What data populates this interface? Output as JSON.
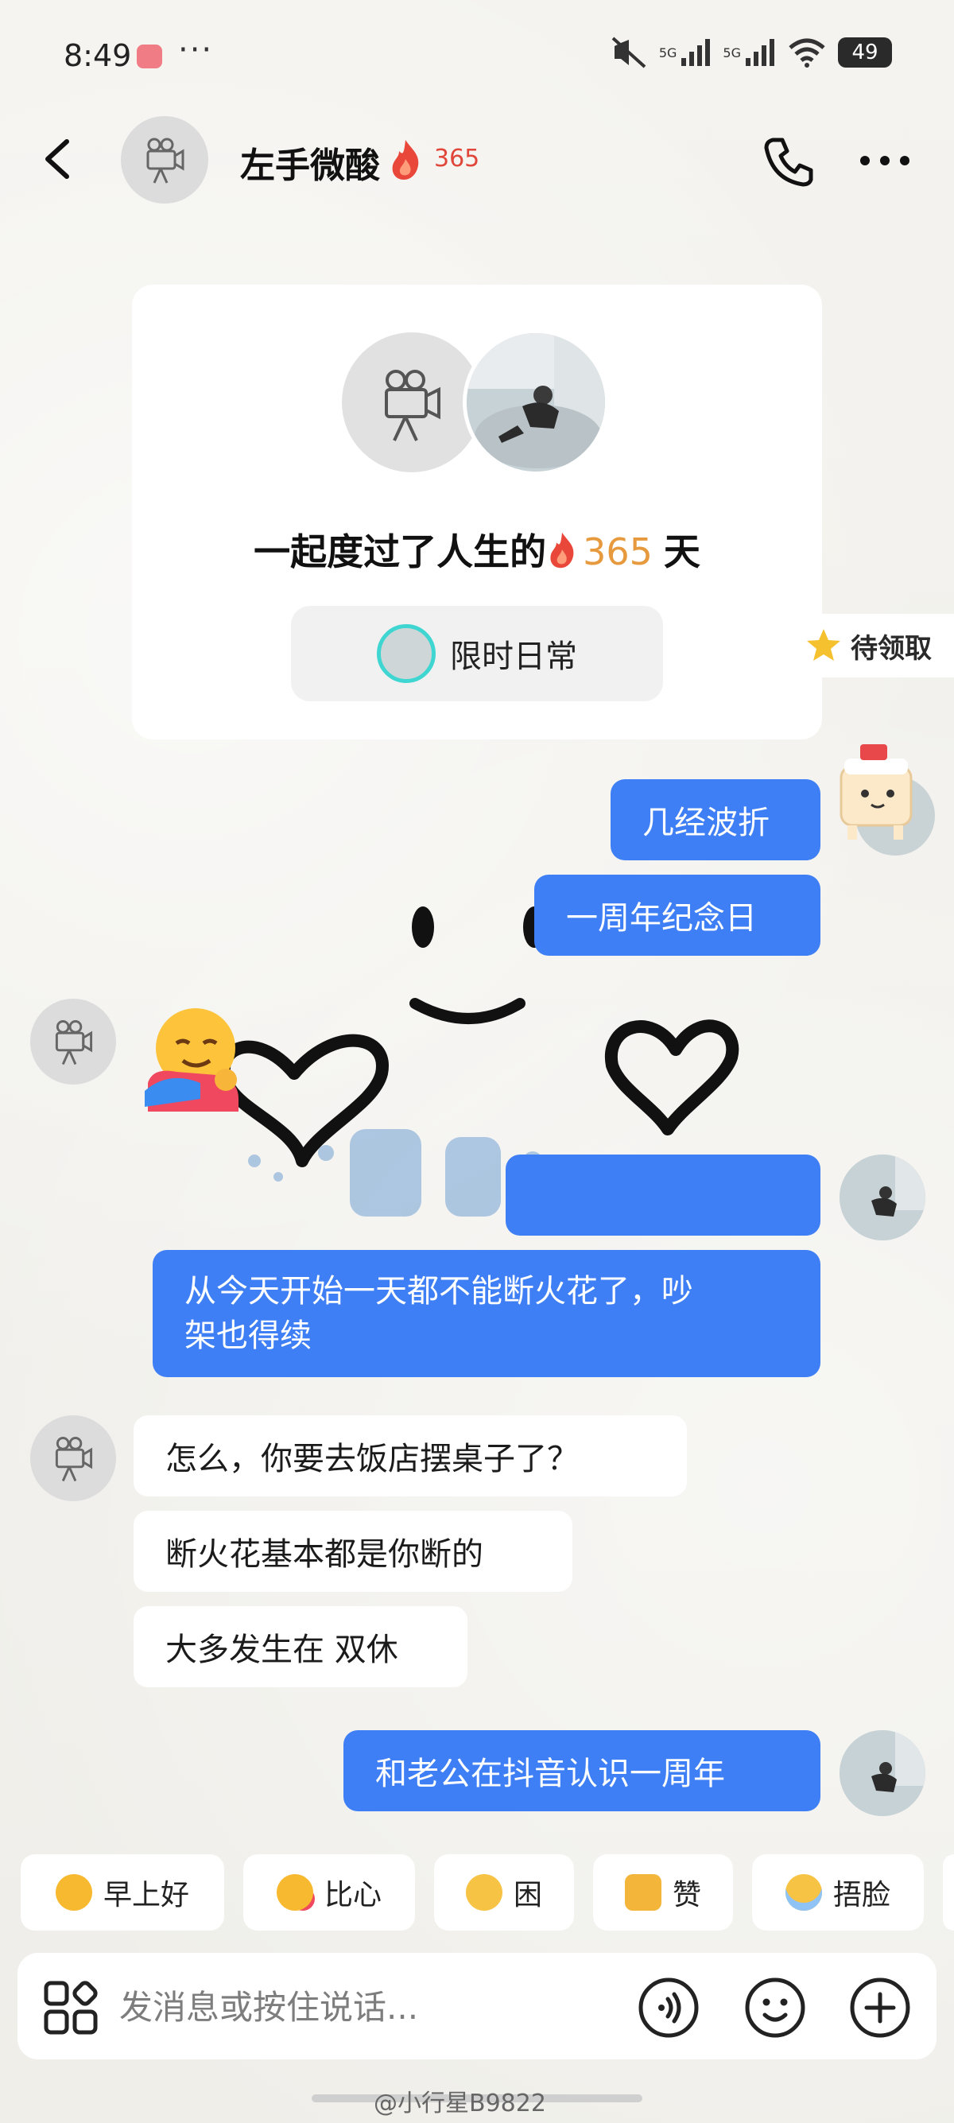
{
  "status_bar": {
    "time": "8:49",
    "more": "···",
    "battery": "49",
    "network_1": "5G",
    "network_2": "5G"
  },
  "header": {
    "contact_name": "左手微酸",
    "streak_count": "365"
  },
  "card": {
    "title_prefix": "一起度过了人生的",
    "days": "365",
    "title_suffix": "天",
    "button_label": "限时日常"
  },
  "claim_pill": {
    "label": "待领取"
  },
  "messages": [
    {
      "side": "out",
      "text": "几经波折"
    },
    {
      "side": "out",
      "text": "一周年纪念日"
    },
    {
      "side": "out",
      "text": "从今天开始一天都不能断火花了，吵"
    },
    {
      "side": "out",
      "text": "架也得续"
    },
    {
      "side": "in",
      "text": "怎么，你要去饭店摆桌子了？"
    },
    {
      "side": "in",
      "text": "断火花基本都是你断的"
    },
    {
      "side": "in",
      "text": "大多发生在 双休"
    },
    {
      "side": "out",
      "text": "和老公在抖音认识一周年"
    }
  ],
  "quick_replies": [
    {
      "label": "早上好",
      "icon": "sun-face-icon"
    },
    {
      "label": "比心",
      "icon": "heart-hands-icon"
    },
    {
      "label": "困",
      "icon": "sleepy-face-icon"
    },
    {
      "label": "赞",
      "icon": "thumbs-up-icon"
    },
    {
      "label": "捂脸",
      "icon": "facepalm-icon"
    }
  ],
  "input": {
    "placeholder": "发消息或按住说话..."
  },
  "watermark": "@小行星B9822",
  "colors": {
    "accent_blue": "#3f7ff6",
    "streak_orange": "#e79a3d",
    "streak_red": "#e0463a",
    "background": "#f1f0ec"
  }
}
